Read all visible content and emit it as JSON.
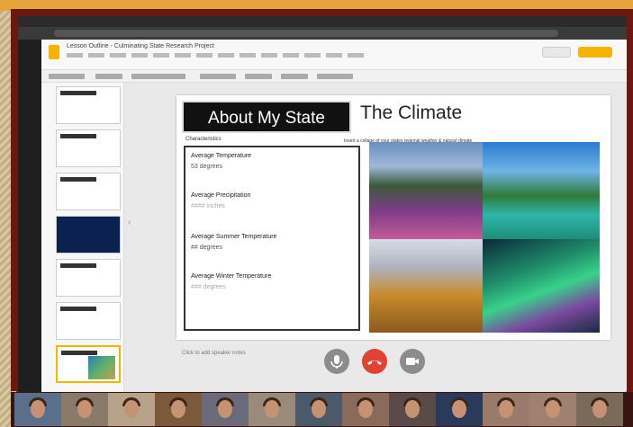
{
  "document": {
    "title": "Lesson Outline - Culminating State Research Project",
    "share_label": "Share",
    "present_label": "Present"
  },
  "slide": {
    "title": "About My State",
    "subtitle": "The Climate",
    "instructions": "Insert a collage of your states regional weather & natural climate",
    "characteristics_label": "Characteristics",
    "fields": [
      {
        "label": "Average Temperature",
        "value": "53 degrees",
        "placeholder": false
      },
      {
        "label": "Average Precipitation",
        "value": "#### inches",
        "placeholder": true
      },
      {
        "label": "Average Summer Temperature",
        "value": "## degrees",
        "placeholder": false
      },
      {
        "label": "Average Winter Temperature",
        "value": "### degrees",
        "placeholder": true
      }
    ]
  },
  "speaker_notes": "Click to add speaker notes",
  "call_controls": {
    "mic": "microphone-icon",
    "end_call": "end-call-icon",
    "camera": "camera-icon"
  },
  "colors": {
    "accent": "#f4b400",
    "end_call": "#e34133",
    "frame": "#7a1e12"
  },
  "participants": [
    "participant-1",
    "participant-2",
    "participant-3",
    "participant-4",
    "participant-5",
    "participant-6",
    "participant-7",
    "participant-8",
    "participant-9",
    "participant-10",
    "participant-11",
    "participant-12",
    "participant-13"
  ]
}
